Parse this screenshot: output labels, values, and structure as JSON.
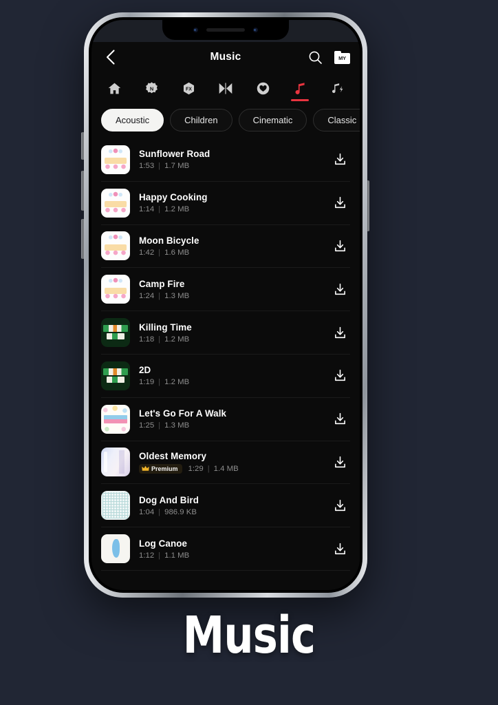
{
  "page": {
    "background_color": "#212634",
    "caption": "Music"
  },
  "header": {
    "title": "Music",
    "back_icon": "chevron-left-icon",
    "search_icon": "search-icon",
    "my_folder_label": "MY"
  },
  "tabbar": {
    "items": [
      {
        "name": "home",
        "icon": "home-icon",
        "active": false
      },
      {
        "name": "new",
        "icon": "new-badge-icon",
        "active": false
      },
      {
        "name": "fx",
        "icon": "fx-hexagon-icon",
        "active": false
      },
      {
        "name": "transition",
        "icon": "transition-bowtie-icon",
        "active": false
      },
      {
        "name": "favorites",
        "icon": "heart-icon",
        "active": false
      },
      {
        "name": "music",
        "icon": "music-note-icon",
        "active": true
      },
      {
        "name": "sound-effects",
        "icon": "music-note-bolt-icon",
        "active": false
      }
    ],
    "active_color": "#e8343f"
  },
  "chips": {
    "items": [
      {
        "label": "Acoustic",
        "selected": true
      },
      {
        "label": "Children",
        "selected": false
      },
      {
        "label": "Cinematic",
        "selected": false
      },
      {
        "label": "Classic",
        "selected": false
      }
    ]
  },
  "list": {
    "download_icon": "download-icon",
    "separator": "|",
    "premium_label": "Premium",
    "premium_icon": "crown-icon",
    "items": [
      {
        "title": "Sunflower Road",
        "duration": "1:53",
        "size": "1.7 MB",
        "art": "art-rabbit",
        "premium": false
      },
      {
        "title": "Happy Cooking",
        "duration": "1:14",
        "size": "1.2 MB",
        "art": "art-rabbit",
        "premium": false
      },
      {
        "title": "Moon Bicycle",
        "duration": "1:42",
        "size": "1.6 MB",
        "art": "art-rabbit",
        "premium": false
      },
      {
        "title": "Camp Fire",
        "duration": "1:24",
        "size": "1.3 MB",
        "art": "art-rabbit",
        "premium": false
      },
      {
        "title": "Killing Time",
        "duration": "1:18",
        "size": "1.2 MB",
        "art": "art-scrabble",
        "premium": false
      },
      {
        "title": "2D",
        "duration": "1:19",
        "size": "1.2 MB",
        "art": "art-scrabble",
        "premium": false
      },
      {
        "title": "Let's Go For A Walk",
        "duration": "1:25",
        "size": "1.3 MB",
        "art": "art-candy",
        "premium": false
      },
      {
        "title": "Oldest Memory",
        "duration": "1:29",
        "size": "1.4 MB",
        "art": "art-memory",
        "premium": true
      },
      {
        "title": "Dog And Bird",
        "duration": "1:04",
        "size": "986.9 KB",
        "art": "art-grid",
        "premium": false
      },
      {
        "title": "Log Canoe",
        "duration": "1:12",
        "size": "1.1 MB",
        "art": "art-canoe",
        "premium": false
      }
    ]
  }
}
